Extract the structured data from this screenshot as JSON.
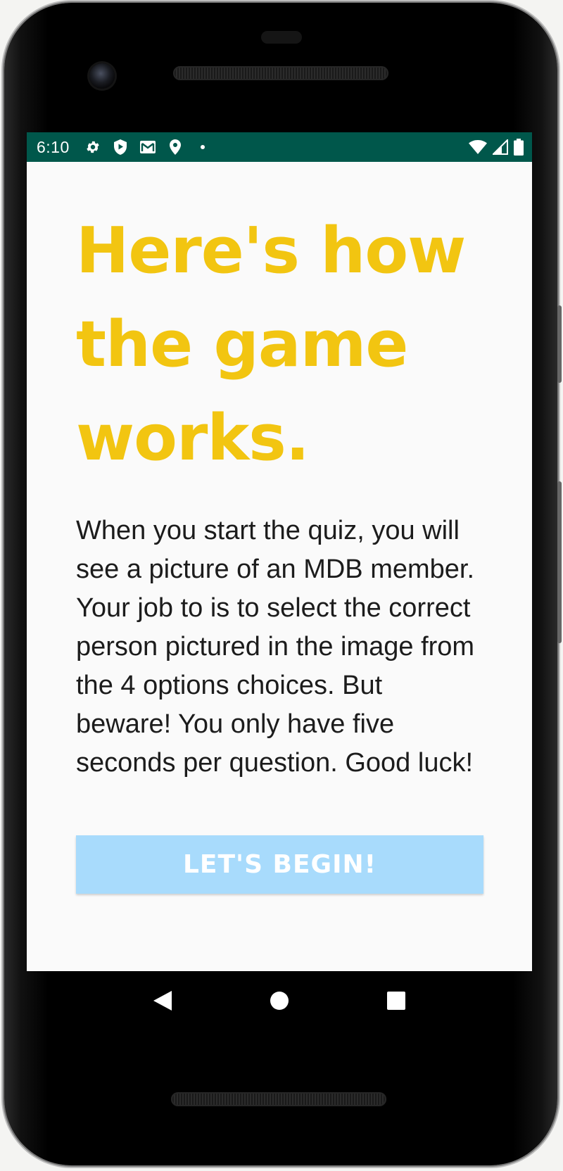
{
  "status_bar": {
    "time": "6:10",
    "left_icons": [
      "settings-icon",
      "shield-play-icon",
      "gmail-icon",
      "location-pin-icon",
      "dot-icon"
    ],
    "right_icons": [
      "wifi-icon",
      "cell-signal-icon",
      "battery-icon"
    ],
    "color": "#00574b"
  },
  "main": {
    "heading": "Here's how the game works.",
    "description": "When you start the quiz, you will see a picture of an MDB member. Your job to is to select the correct person pictured in the image from the 4 options choices. But beware! You only have five seconds per question. Good luck!",
    "begin_button": "LET'S BEGIN!",
    "heading_color": "#f2c511",
    "button_color": "#a8dbfc"
  },
  "nav_bar": {
    "buttons": [
      "back-icon",
      "home-icon",
      "recents-icon"
    ]
  }
}
